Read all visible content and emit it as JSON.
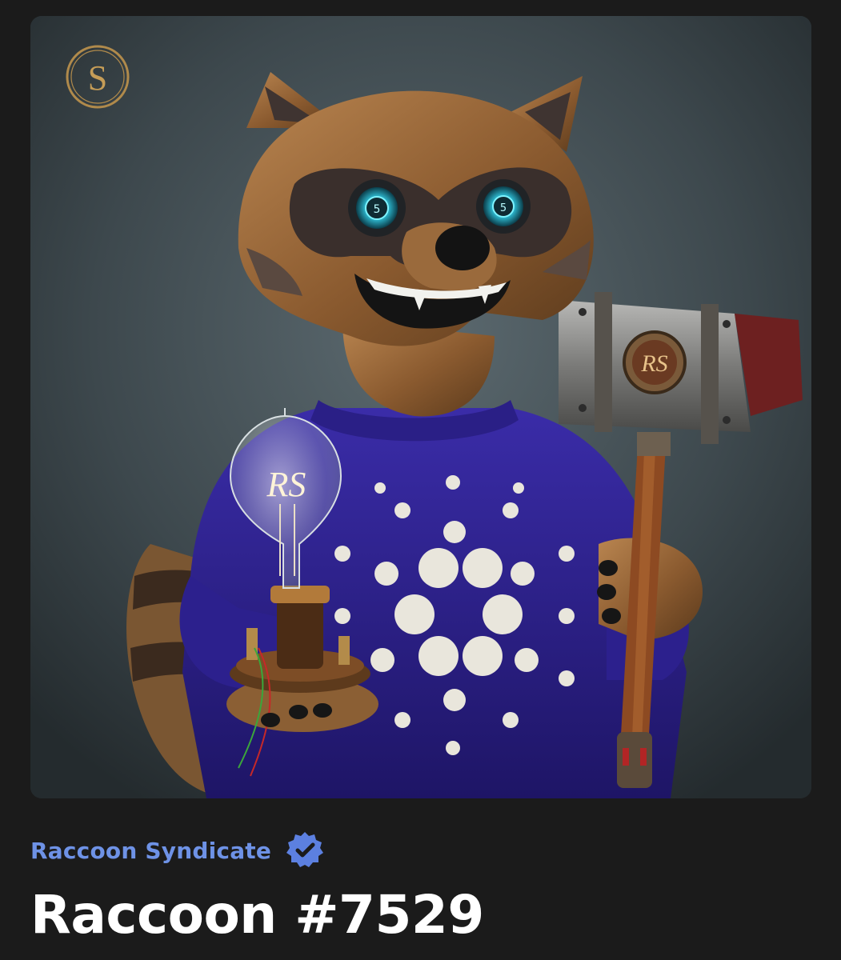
{
  "nft": {
    "image_icon": "raccoon-artwork",
    "logo_letter": "S",
    "bulb_monogram": "RS",
    "hammer_monogram": "RS",
    "eye_monogram": "5",
    "colors": {
      "background": "#1b1b1b",
      "card_bg": "#3f4b51",
      "sweater": "#2c1f8a",
      "wood": "#a0703f",
      "eye_glow": "#3ee6ff",
      "logo_gold": "#b08a4b"
    }
  },
  "collection": {
    "name": "Raccoon Syndicate",
    "verified_icon": "verified-badge-icon",
    "accent": "#6e92e6"
  },
  "token": {
    "title": "Raccoon #7529"
  }
}
